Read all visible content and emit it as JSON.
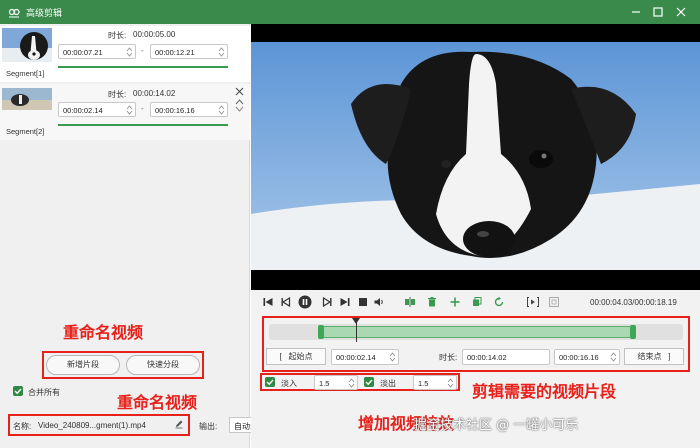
{
  "window": {
    "title": "高级剪辑",
    "accent": "#3a8a4c"
  },
  "segments": [
    {
      "label": "Segment[1]",
      "duration_label": "时长:",
      "duration": "00:00:05.00",
      "start": "00:00:07.21",
      "end": "00:00:12.21"
    },
    {
      "label": "Segment[2]",
      "duration_label": "时长:",
      "duration": "00:00:14.02",
      "start": "00:00:02.14",
      "end": "00:00:16.16"
    }
  ],
  "left": {
    "add_segment_label": "新增片段",
    "quick_split_label": "快速分段",
    "merge_all_label": "合并所有",
    "name_label": "名称:",
    "name_value": "Video_240809...gment(1).mp4",
    "output_label": "输出:",
    "output_value": "自动:Auto"
  },
  "playback": {
    "current_time": "00:00:04.03",
    "total_time": "00:00:18.19",
    "time_separator": "/"
  },
  "trim": {
    "start_bracket": "[",
    "start_label": "起始点",
    "start_value": "00:00:02.14",
    "duration_label": "时长:",
    "duration_value": "00:00:14.02",
    "end_value": "00:00:16.16",
    "end_label": "结束点",
    "end_bracket": "]"
  },
  "effects": {
    "fade_in_label": "淡入",
    "fade_in_value": "1.5",
    "fade_out_label": "淡出",
    "fade_out_value": "1.5"
  },
  "annotations": {
    "rename_top": "重命名视频",
    "rename_bottom": "重命名视频",
    "clip_segments": "剪辑需要的视频片段",
    "add_effects": "增加视频特效",
    "watermark": "掘金技术社区 @ 一罐小可乐",
    "color": "#e8201a"
  }
}
